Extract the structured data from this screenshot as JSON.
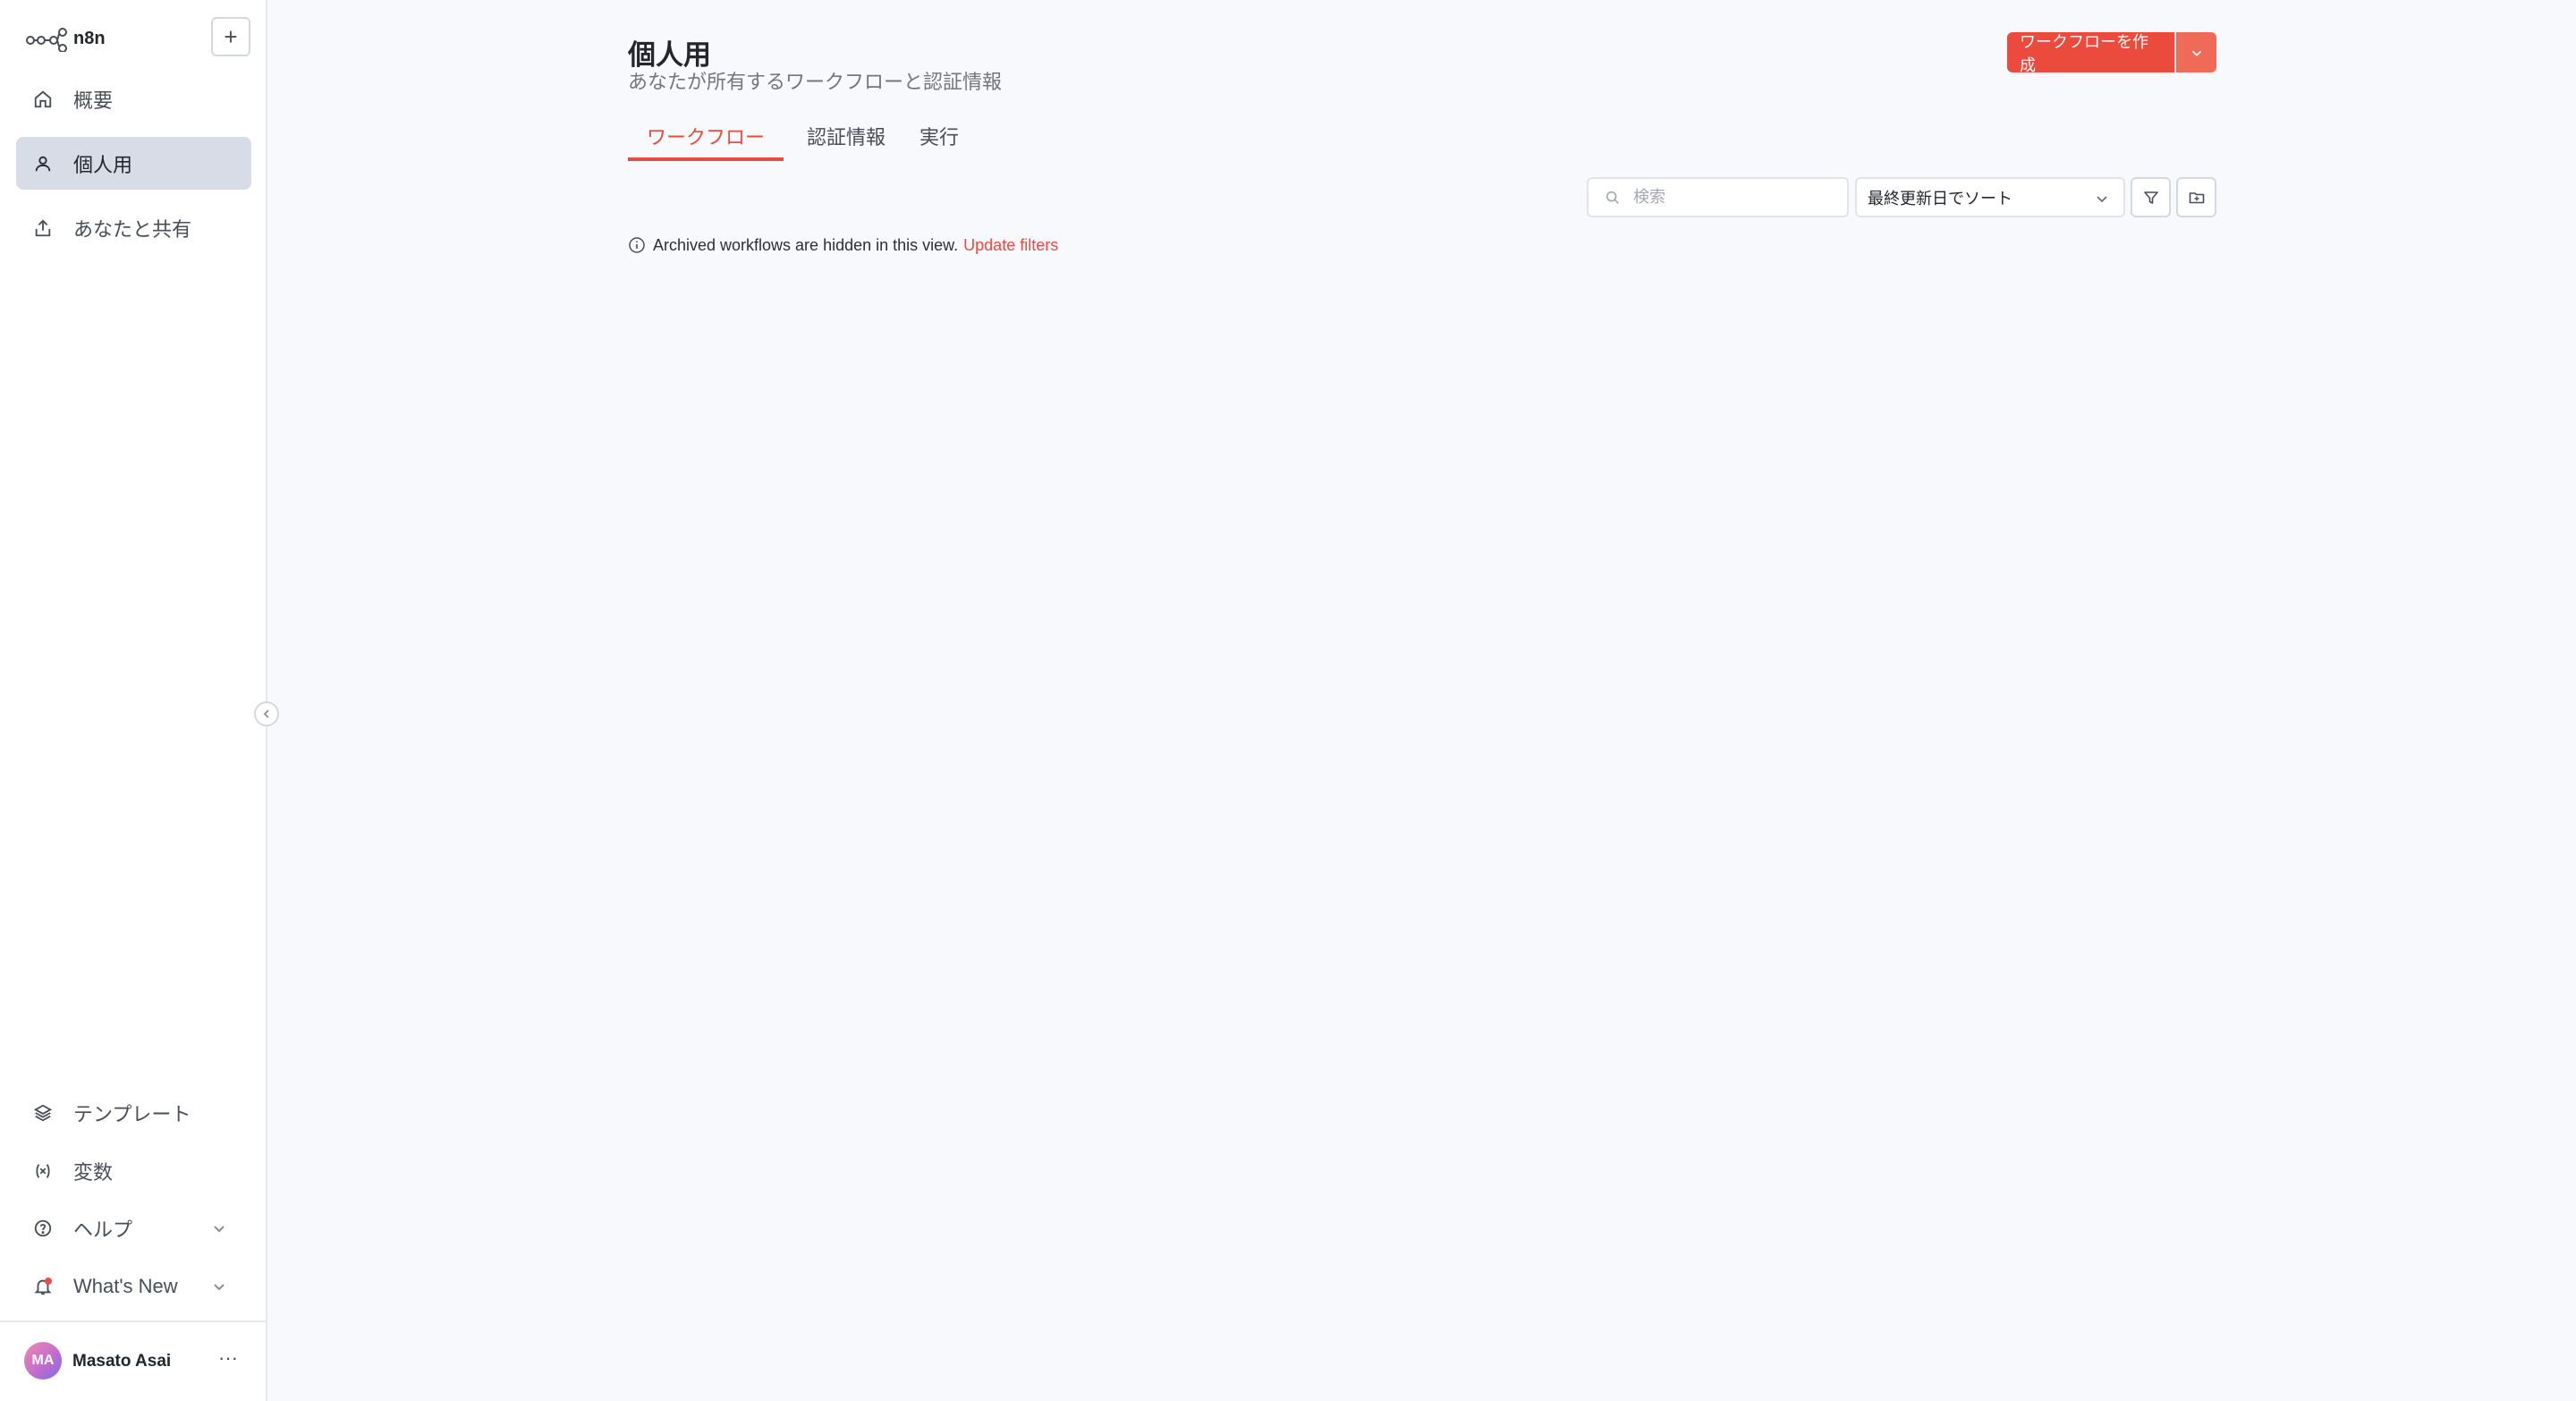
{
  "brand": {
    "name": "n8n"
  },
  "sidebar": {
    "add_label": "+",
    "top_items": [
      {
        "label": "概要",
        "icon": "home-icon",
        "active": false
      },
      {
        "label": "個人用",
        "icon": "user-icon",
        "active": true
      },
      {
        "label": "あなたと共有",
        "icon": "share-icon",
        "active": false
      }
    ],
    "bottom_items": [
      {
        "label": "テンプレート",
        "icon": "templates-icon"
      },
      {
        "label": "変数",
        "icon": "variables-icon"
      },
      {
        "label": "ヘルプ",
        "icon": "help-icon"
      },
      {
        "label": "What's New",
        "icon": "bell-icon"
      }
    ],
    "user": {
      "initials": "MA",
      "name": "Masato Asai",
      "menu": "···"
    }
  },
  "header": {
    "title": "個人用",
    "subtitle": "あなたが所有するワークフローと認証情報",
    "create_button": "ワークフローを作成"
  },
  "tabs": [
    {
      "label": "ワークフロー",
      "active": true
    },
    {
      "label": "認証情報",
      "active": false
    },
    {
      "label": "実行",
      "active": false
    }
  ],
  "toolbar": {
    "search_placeholder": "検索",
    "sort_value": "最終更新日でソート"
  },
  "notice": {
    "text": "Archived workflows are hidden in this view.",
    "link": "Update filters"
  },
  "colors": {
    "accent": "#ea4b3c",
    "sidebar_active_bg": "#d8dce6",
    "background": "#f8f9fc"
  }
}
